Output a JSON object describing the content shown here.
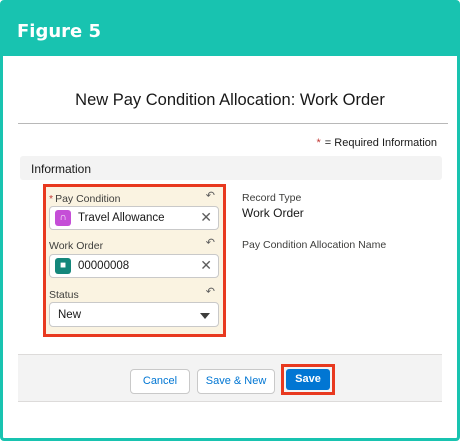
{
  "figure": {
    "title": "Figure 5"
  },
  "modal": {
    "title": "New Pay Condition Allocation: Work Order",
    "required_star": "*",
    "required_note": "= Required Information"
  },
  "section": {
    "label": "Information"
  },
  "fields": {
    "pay_condition": {
      "required_mark": "*",
      "label": "Pay Condition",
      "value": "Travel Allowance",
      "icon": "headset-icon",
      "icon_color": "#c54ed7"
    },
    "work_order": {
      "label": "Work Order",
      "value": "00000008",
      "icon": "truck-icon",
      "icon_color": "#14877b"
    },
    "status": {
      "label": "Status",
      "value": "New"
    }
  },
  "info": {
    "record_type_label": "Record Type",
    "record_type_value": "Work Order",
    "allocation_name_label": "Pay Condition Allocation Name"
  },
  "footer": {
    "cancel_label": "Cancel",
    "save_new_label": "Save & New",
    "save_label": "Save"
  },
  "colors": {
    "figure_accent": "#18c3b0",
    "highlight_red": "#e8391f",
    "brand_blue": "#0176d3"
  }
}
